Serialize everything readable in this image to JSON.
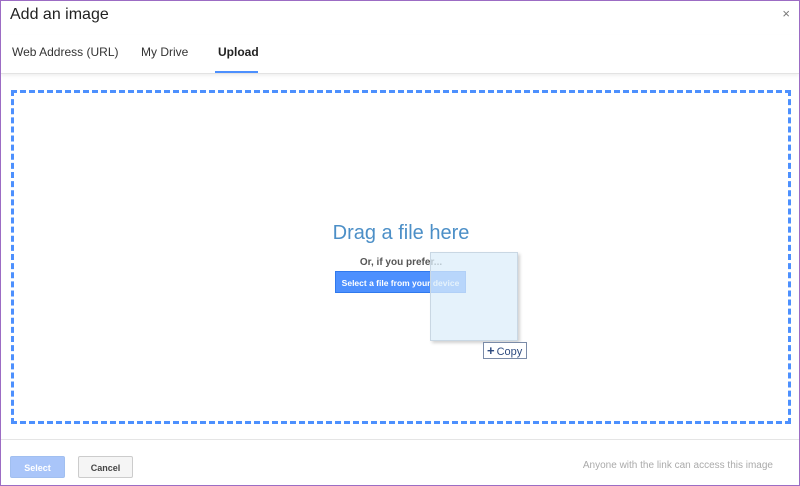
{
  "dialog": {
    "title": "Add an image",
    "close_glyph": "×"
  },
  "tabs": [
    {
      "label": "Web Address (URL)",
      "active": false
    },
    {
      "label": "My Drive",
      "active": false
    },
    {
      "label": "Upload",
      "active": true
    }
  ],
  "upload": {
    "drag_title": "Drag a file here",
    "or_text": "Or, if you prefer...",
    "select_button": "Select a file from your device"
  },
  "drag_feedback": {
    "plus_glyph": "+",
    "copy_label": "Copy"
  },
  "footer": {
    "select_label": "Select",
    "select_enabled": false,
    "cancel_label": "Cancel",
    "note": "Anyone with the link can access this image"
  },
  "colors": {
    "accent": "#4d90fe",
    "drag_title": "#4c8fc7",
    "dialog_border": "#9c6cc4"
  },
  "icons": {
    "close": "close-icon",
    "plus": "plus-icon"
  }
}
